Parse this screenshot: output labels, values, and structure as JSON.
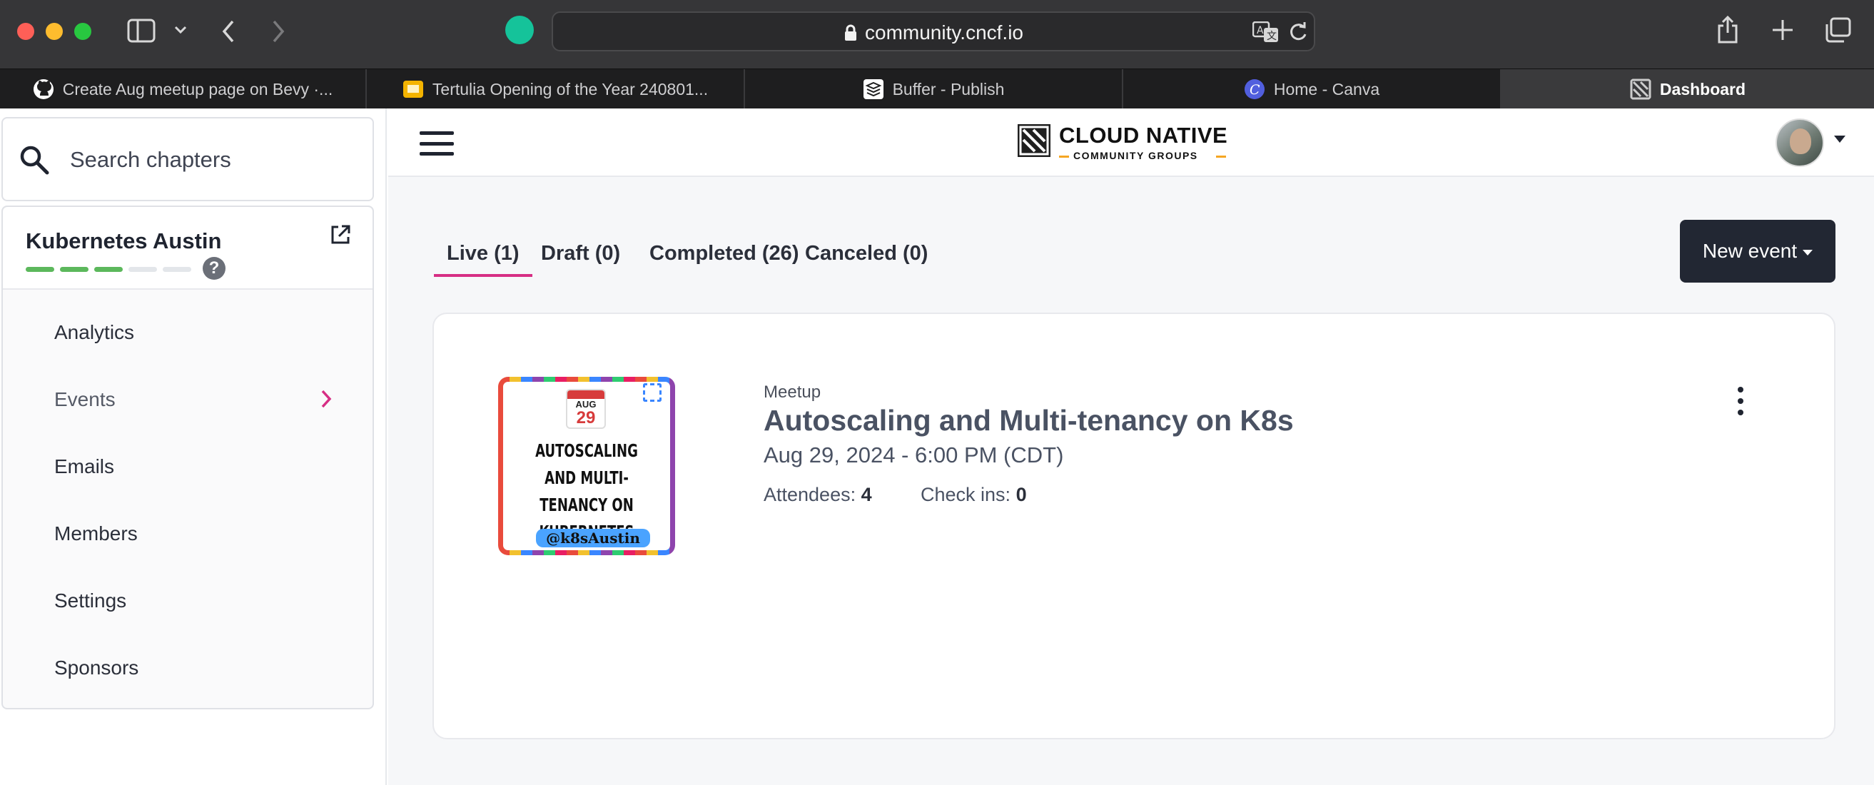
{
  "browser": {
    "url": "community.cncf.io",
    "tabs": [
      {
        "label": "Create Aug meetup page on Bevy ·...",
        "favicon": "github-icon",
        "color": "#ffffff"
      },
      {
        "label": "Tertulia Opening of the Year 240801...",
        "favicon": "slides-icon",
        "color": "#f4b400"
      },
      {
        "label": "Buffer - Publish",
        "favicon": "buffer-icon",
        "color": "#ffffff"
      },
      {
        "label": "Home - Canva",
        "favicon": "canva-icon",
        "color": "#7d2ae8"
      },
      {
        "label": "Dashboard",
        "favicon": "cncf-icon",
        "color": "#cccccc",
        "active": true
      }
    ]
  },
  "sidebar": {
    "search_placeholder": "Search chapters",
    "chapter_name": "Kubernetes Austin",
    "progress": {
      "completed": 3,
      "total": 5
    },
    "help_glyph": "?",
    "items": [
      {
        "label": "Analytics"
      },
      {
        "label": "Events",
        "selected": true
      },
      {
        "label": "Emails"
      },
      {
        "label": "Members"
      },
      {
        "label": "Settings"
      },
      {
        "label": "Sponsors"
      }
    ]
  },
  "header": {
    "logo_title": "CLOUD NATIVE",
    "logo_subtitle": "COMMUNITY GROUPS"
  },
  "event_tabs": [
    {
      "label": "Live (1)",
      "active": true
    },
    {
      "label": "Draft (0)"
    },
    {
      "label": "Completed (26)"
    },
    {
      "label": "Canceled (0)"
    }
  ],
  "new_event_label": "New event",
  "event": {
    "type": "Meetup",
    "title": "Autoscaling and Multi-tenancy on K8s",
    "date": "Aug 29, 2024 - 6:00 PM (CDT)",
    "attendees_label": "Attendees:",
    "attendees_value": "4",
    "checkins_label": "Check ins:",
    "checkins_value": "0",
    "thumbnail": {
      "month": "AUG",
      "day": "29",
      "title": "AUTOSCALING AND MULTI-TENANCY ON KUBERNETES",
      "handle": "@k8sAustin"
    }
  },
  "colors": {
    "accent_pink": "#d62e84",
    "progress_done": "#5cb85c",
    "progress_todo": "#e3e6ea",
    "button_dark": "#222733"
  }
}
